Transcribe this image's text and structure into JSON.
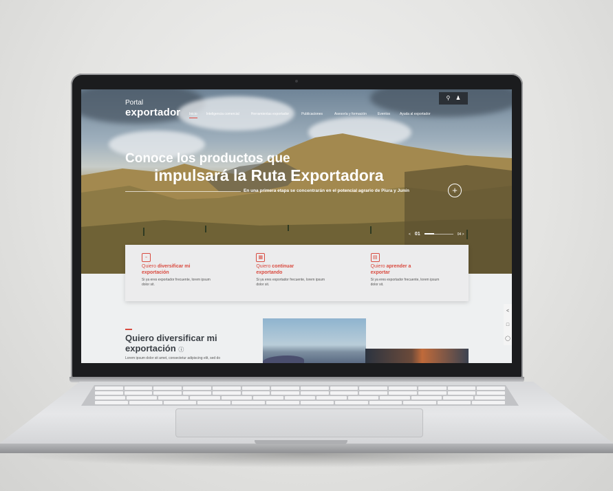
{
  "site": {
    "logo_line1": "Portal",
    "logo_line2": "exportador"
  },
  "nav": {
    "items": [
      {
        "label": "Inicio",
        "active": true
      },
      {
        "label": "Inteligencia comercial",
        "active": false
      },
      {
        "label": "Herramientas exportador",
        "active": false
      },
      {
        "label": "Publicaciones",
        "active": false
      },
      {
        "label": "Asesoría y formación",
        "active": false
      },
      {
        "label": "Eventos",
        "active": false
      },
      {
        "label": "Ayuda al exportador",
        "active": false
      }
    ],
    "search_icon": "search-icon",
    "user_icon": "user-icon"
  },
  "hero": {
    "title_line1": "Conoce los productos que",
    "title_line2": "impulsará la Ruta Exportadora",
    "subtitle": "En una primera etapa se concentrarán en el potencial agrario de Piura y Junín",
    "plus_label": "+",
    "pager_prefix": "< ",
    "pager_current": "01",
    "pager_total": "04 >"
  },
  "cards": [
    {
      "pre": "Quiero ",
      "bold": "diversificar mi exportación",
      "desc": "Si ya eres exportador frecuente, lorem ipsum dolor sit.",
      "icon": "box-icon"
    },
    {
      "pre": "Quiero ",
      "bold": "continuar exportando",
      "desc": "Si ya eres exportador frecuente, lorem ipsum dolor sit.",
      "icon": "boxes-icon"
    },
    {
      "pre": "Quiero ",
      "bold": "aprender a exportar",
      "desc": "Si ya eres exportador frecuente, lorem ipsum dolor sit.",
      "icon": "document-icon"
    }
  ],
  "section": {
    "title": "Quiero diversificar mi exportación",
    "info_icon": "ⓘ",
    "text": "Lorem ipsum dolor sit amet, consectetur adipiscing elit, sed do"
  },
  "share": {
    "icons": [
      "share-icon",
      "chat-icon",
      "whatsapp-icon"
    ]
  },
  "colors": {
    "accent": "#d94a3f",
    "bezel": "#1b1c1e",
    "aluminum": "#d7d8da"
  }
}
